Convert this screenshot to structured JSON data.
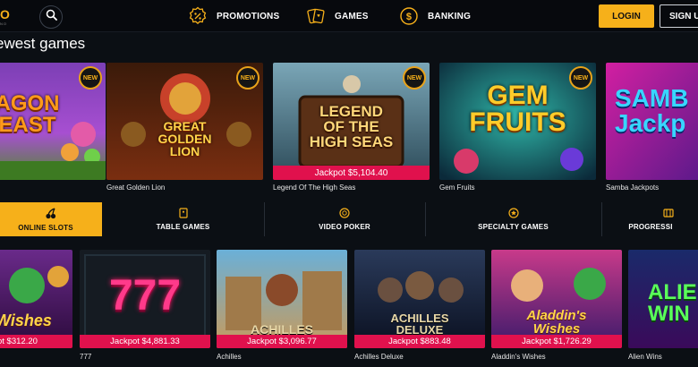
{
  "header": {
    "logo_text": "O",
    "logo_sub": "NO",
    "nav": [
      {
        "label": "PROMOTIONS",
        "icon": "percent-badge-icon"
      },
      {
        "label": "GAMES",
        "icon": "cards-icon"
      },
      {
        "label": "BANKING",
        "icon": "dollar-coin-icon"
      }
    ],
    "login_label": "LOGIN",
    "signup_label": "SIGN U"
  },
  "section_title": "ewest games",
  "newest_games": [
    {
      "name": "",
      "art_text": "AGON\nEAST",
      "badge": "NEW",
      "jackpot": ""
    },
    {
      "name": "Great Golden Lion",
      "art_text": "GREAT\nGOLDEN\nLION",
      "badge": "NEW",
      "jackpot": ""
    },
    {
      "name": "Legend Of The High Seas",
      "art_text": "LEGEND\nOF THE\nHIGH SEAS",
      "badge": "NEW",
      "jackpot": "Jackpot $5,104.40"
    },
    {
      "name": "Gem Fruits",
      "art_text": "GEM\nFRUITS",
      "badge": "NEW",
      "jackpot": ""
    },
    {
      "name": "Samba Jackpots",
      "art_text": "SAMB\nJackp",
      "badge": "",
      "jackpot": ""
    }
  ],
  "tabs": [
    {
      "label": "ONLINE SLOTS",
      "icon": "cherries-icon",
      "active": true
    },
    {
      "label": "TABLE GAMES",
      "icon": "cards-icon",
      "active": false
    },
    {
      "label": "VIDEO POKER",
      "icon": "poker-chip-icon",
      "active": false
    },
    {
      "label": "SPECIALTY GAMES",
      "icon": "star-icon",
      "active": false
    },
    {
      "label": "PROGRESSI",
      "icon": "progressive-icon",
      "active": false
    }
  ],
  "slots": [
    {
      "name": "",
      "art_text": "Wishes",
      "jackpot": "ot $312.20"
    },
    {
      "name": "777",
      "art_text": "777",
      "jackpot": "Jackpot $4,881.33"
    },
    {
      "name": "Achilles",
      "art_text": "ACHILLES",
      "jackpot": "Jackpot $3,096.77"
    },
    {
      "name": "Achilles Deluxe",
      "art_text": "ACHILLES\nDELUXE",
      "jackpot": "Jackpot $883.48"
    },
    {
      "name": "Aladdin's Wishes",
      "art_text": "Aladdin's\nWishes",
      "jackpot": "Jackpot $1,726.29"
    },
    {
      "name": "Alien Wins",
      "art_text": "ALIE\nWIN",
      "jackpot": ""
    }
  ],
  "colors": {
    "accent": "#f6b01a",
    "jackpot": "#e0114d",
    "background": "#0b0f14"
  }
}
